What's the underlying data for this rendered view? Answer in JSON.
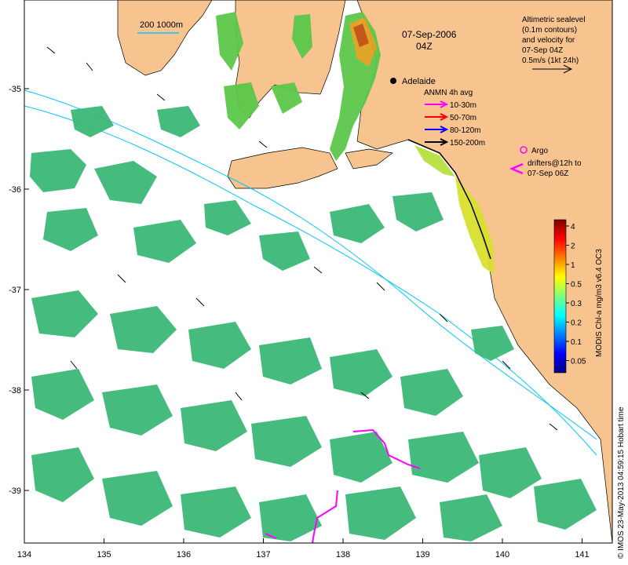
{
  "map": {
    "date_label": "07-Sep-2006",
    "time_label": "04Z",
    "city": "Adelaide",
    "scale_bar": "200  1000m",
    "x_ticks": [
      "134",
      "135",
      "136",
      "137",
      "138",
      "139",
      "140",
      "141"
    ],
    "y_ticks": [
      "-35",
      "-36",
      "-37",
      "-38",
      "-39"
    ],
    "credit": "© IMOS 23-May-2013 04:59:15 Hobart time",
    "altimetry_note": [
      "Altimetric sealevel",
      "(0.1m contours)",
      "and velocity for",
      "07-Sep 04Z",
      "0.5m/s (1kt 24h)"
    ],
    "anmn_title": "ANMN 4h avg",
    "anmn_legend": [
      {
        "label": "10-30m",
        "color": "#ff00ff"
      },
      {
        "label": "50-70m",
        "color": "#ff0000"
      },
      {
        "label": "80-120m",
        "color": "#0000ff"
      },
      {
        "label": "150-200m",
        "color": "#000000"
      }
    ],
    "argo_label": "Argo",
    "drifter_label": [
      "drifters@12h to",
      "07-Sep 06Z"
    ],
    "colorbar": {
      "title": "MODIS Chl-a mg/m3 v6.4 OC3",
      "ticks": [
        "4",
        "2",
        "1",
        "0.5",
        "0.3",
        "0.2",
        "0.1",
        "0.05"
      ],
      "colors": [
        "#00007f",
        "#0000ff",
        "#007fff",
        "#00ffff",
        "#7fff7f",
        "#ffff00",
        "#ff7f00",
        "#ff0000",
        "#7f0000"
      ]
    },
    "colors": {
      "land": "#f7c38f",
      "ocean": "#ffffff",
      "chl_low": "#3cb878",
      "chl_mid": "#5cc84a",
      "contour": "#00c8ff",
      "drifter": "#ff00ff"
    }
  }
}
